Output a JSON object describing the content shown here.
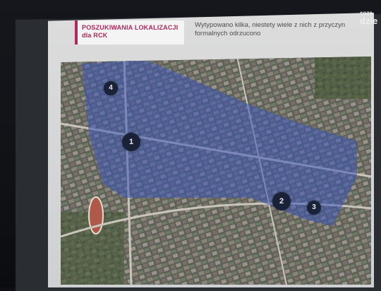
{
  "slide": {
    "title_line1": "POSZUKIWANIA LOKALIZACJI",
    "title_line2": "dla RCK",
    "subtitle": "Wytypowano kilka, niestety wiele z nich z przyczyn formalnych odrzucono"
  },
  "logo": {
    "line1": "coza",
    "line2": "dzie"
  },
  "map": {
    "highlight_color": "#3a56b8",
    "markers": [
      "1",
      "2",
      "3",
      "4"
    ]
  }
}
